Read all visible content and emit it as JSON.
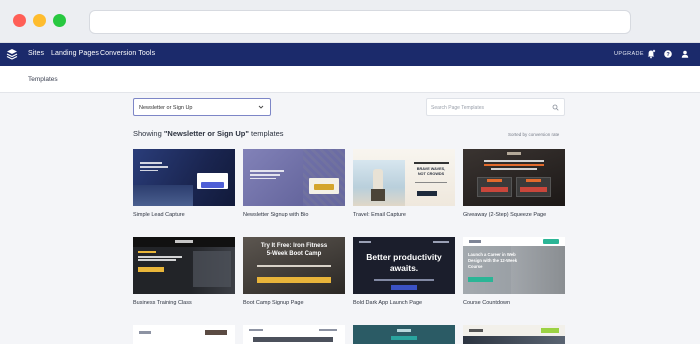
{
  "nav": {
    "items": [
      "Sites",
      "Landing Pages",
      "Conversion Tools"
    ],
    "upgrade": "UPGRADE",
    "icons": [
      "bell-icon",
      "help-icon",
      "user-icon"
    ]
  },
  "subheader": {
    "title": "Templates"
  },
  "filter": {
    "selected": "Newsletter or Sign Up",
    "search_placeholder": "Search Page Templates"
  },
  "results": {
    "prefix": "Showing ",
    "query": "\"Newsletter or Sign Up\"",
    "suffix": " templates",
    "sort_label": "Sorted by conversion rate"
  },
  "templates": [
    {
      "name": "Simple Lead Capture"
    },
    {
      "name": "Newsletter Signup with Bio"
    },
    {
      "name": "Travel: Email Capture"
    },
    {
      "name": "Giveaway (2-Step) Squeeze Page"
    },
    {
      "name": "Business Training Class"
    },
    {
      "name": "Boot Camp Signup Page"
    },
    {
      "name": "Bold Dark App Launch Page"
    },
    {
      "name": "Course Countdown"
    }
  ],
  "thumb_text": {
    "travel_headline_1": "BRAVE WAVES,",
    "travel_headline_2": "NOT CROWDS",
    "bootcamp_1": "Try It Free: Iron Fitness",
    "bootcamp_2": "5-Week Boot Camp",
    "productivity_1": "Better productivity",
    "productivity_2": "awaits.",
    "course_1": "Launch a Career in Web",
    "course_2": "Design with the 12-Week",
    "course_3": "Course"
  },
  "colors": {
    "nav": "#1b2a6b",
    "accent": "#3b52c4",
    "background": "#f4f5f8"
  }
}
